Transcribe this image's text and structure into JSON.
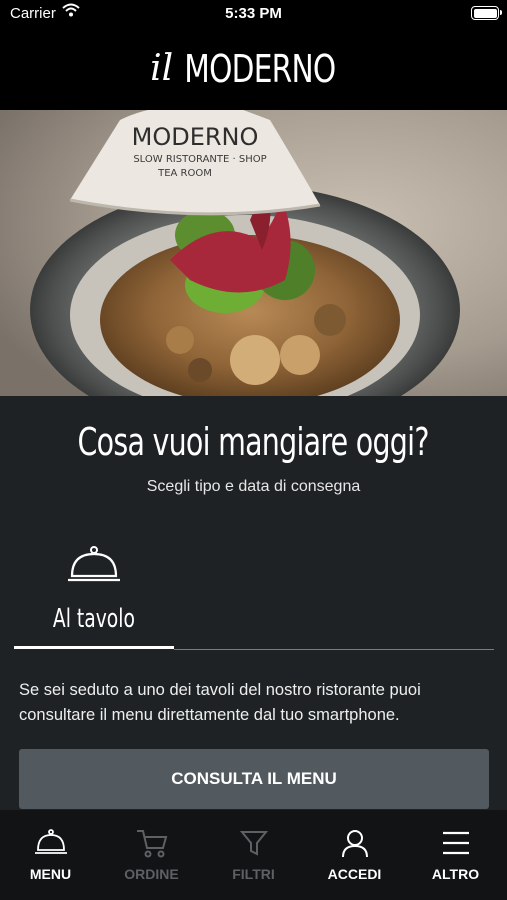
{
  "status_bar": {
    "carrier": "Carrier",
    "time": "5:33 PM"
  },
  "header": {
    "logo_prefix": "il",
    "logo_name": "MODERNO"
  },
  "hero": {
    "bowl_lid_lines": [
      "MODERNO",
      "SLOW RISTORANTE · SHOP",
      "TEA ROOM"
    ]
  },
  "main": {
    "headline": "Cosa vuoi mangiare oggi?",
    "subtitle": "Scegli tipo e data di consegna",
    "tabs": [
      {
        "label": "Al tavolo",
        "icon": "cloche-icon"
      }
    ],
    "description": "Se sei seduto a uno dei tavoli del nostro ristorante puoi consultare il menu direttamente dal tuo smartphone.",
    "cta_label": "CONSULTA IL MENU"
  },
  "tabbar": {
    "items": [
      {
        "label": "MENU",
        "icon": "cloche-icon",
        "state": "active"
      },
      {
        "label": "ORDINE",
        "icon": "cart-icon",
        "state": "disabled"
      },
      {
        "label": "FILTRI",
        "icon": "filter-icon",
        "state": "disabled"
      },
      {
        "label": "ACCEDI",
        "icon": "user-icon",
        "state": "enabled"
      },
      {
        "label": "ALTRO",
        "icon": "menu-icon",
        "state": "enabled"
      }
    ]
  },
  "colors": {
    "background": "#1e2224",
    "button": "#525a60",
    "tabbar": "#111314",
    "disabled": "#5d6164"
  }
}
